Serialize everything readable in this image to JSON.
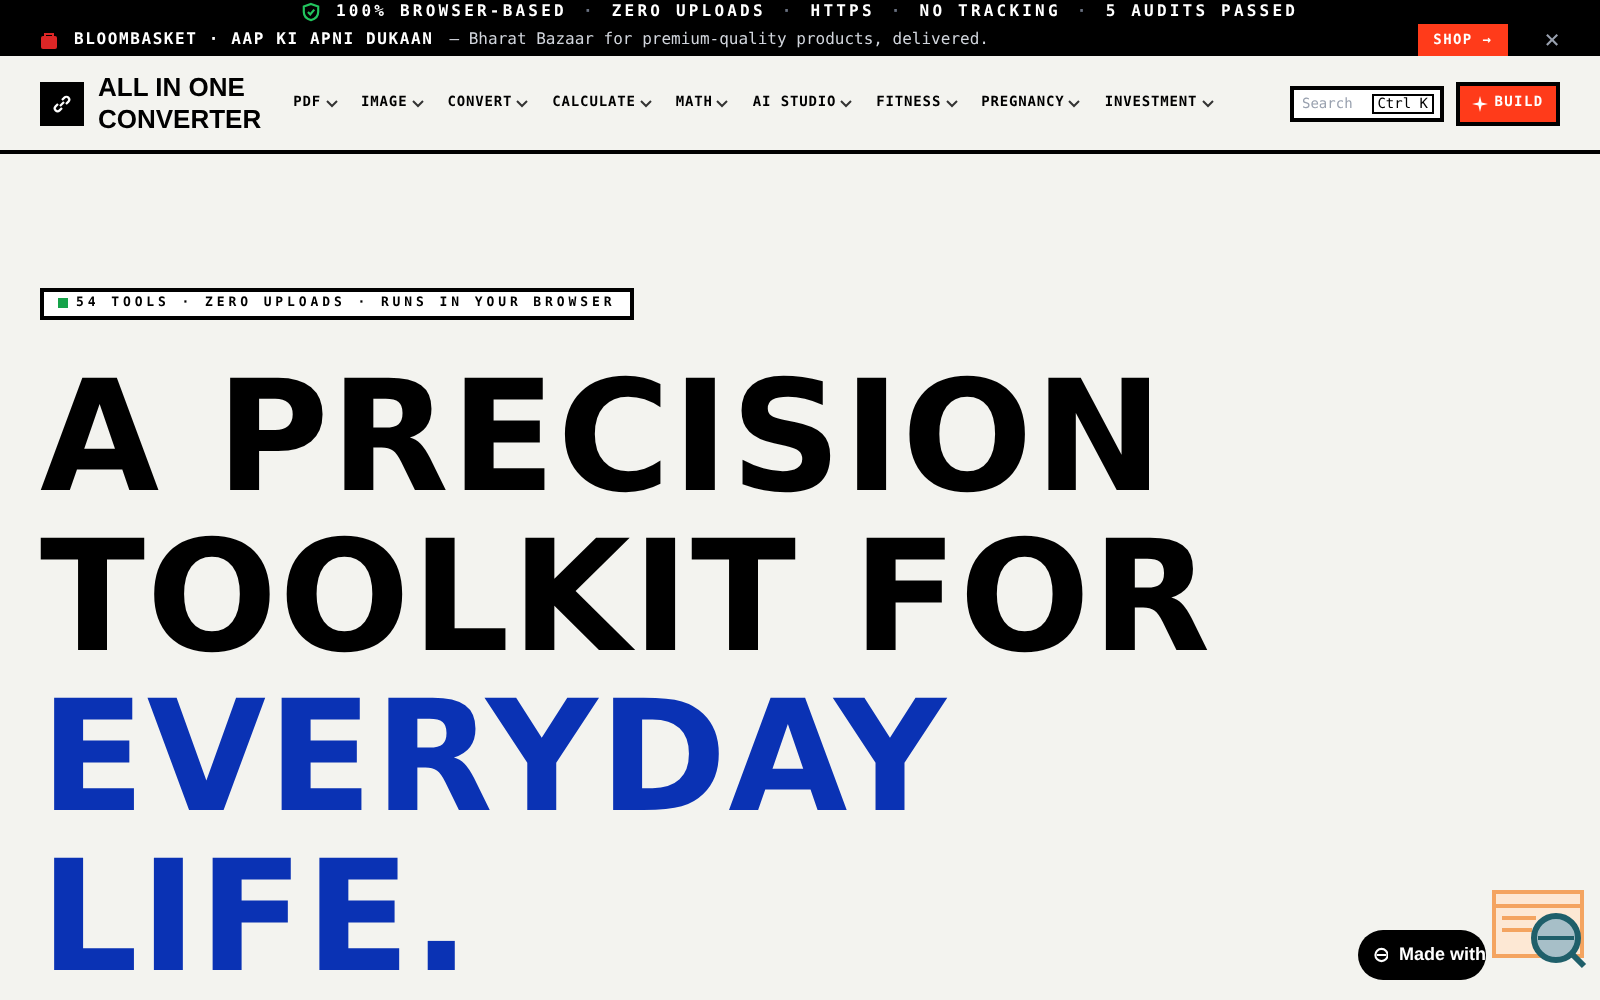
{
  "trust_bar": [
    "100% BROWSER-BASED",
    "ZERO UPLOADS",
    "HTTPS",
    "NO TRACKING",
    "5 AUDITS PASSED"
  ],
  "trust_separator": "·",
  "promo": {
    "brand": "BLOOMBASKET · AAP KI APNI DUKAAN",
    "text": "— Bharat Bazaar for premium-quality products, delivered.",
    "button": "SHOP →",
    "close": "×"
  },
  "header": {
    "logo_lines": [
      "ALL IN ONE",
      "CONVERTER"
    ],
    "nav": [
      "PDF",
      "IMAGE",
      "CONVERT",
      "CALCULATE",
      "MATH",
      "AI STUDIO",
      "FITNESS",
      "PREGNANCY",
      "INVESTMENT"
    ],
    "search": {
      "placeholder": "Search",
      "shortcut": "Ctrl K"
    },
    "build_button": "BUILD"
  },
  "hero": {
    "badge": {
      "text": "54 TOOLS · ZERO UPLOADS · RUNS IN YOUR BROWSER",
      "color": "#16a34a"
    },
    "headline": [
      {
        "text": "A PRECISION",
        "accent": false
      },
      {
        "text": "TOOLKIT FOR",
        "accent": false
      },
      {
        "text": "EVERYDAY",
        "accent": true
      },
      {
        "text": "LIFE.",
        "accent": true
      }
    ]
  },
  "made_with": {
    "text": "Made with"
  }
}
